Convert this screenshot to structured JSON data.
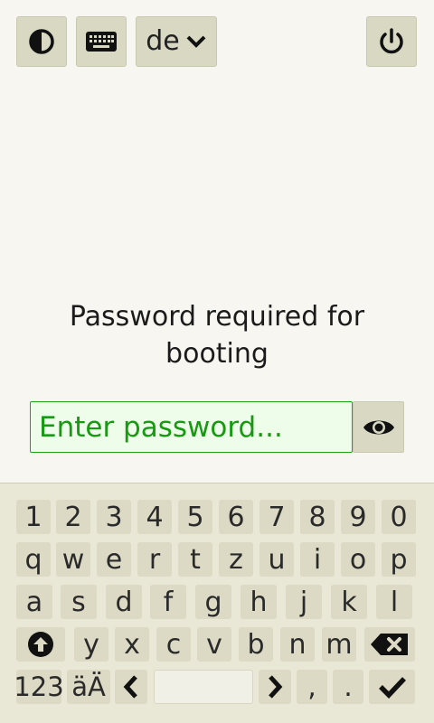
{
  "header": {
    "theme_icon": "half-circle-contrast-icon",
    "keyboard_icon": "keyboard-icon",
    "language": "de",
    "language_chevron_icon": "chevron-down-icon",
    "power_icon": "power-icon"
  },
  "prompt": {
    "title_line1": "Password required for",
    "title_line2": "booting"
  },
  "password": {
    "placeholder": "Enter password...",
    "value": "",
    "reveal_icon": "eye-icon"
  },
  "keyboard": {
    "row1": [
      "1",
      "2",
      "3",
      "4",
      "5",
      "6",
      "7",
      "8",
      "9",
      "0"
    ],
    "row2": [
      "q",
      "w",
      "e",
      "r",
      "t",
      "z",
      "u",
      "i",
      "o",
      "p"
    ],
    "row3": [
      "a",
      "s",
      "d",
      "f",
      "g",
      "h",
      "j",
      "k",
      "l"
    ],
    "row4": [
      "y",
      "x",
      "c",
      "v",
      "b",
      "n",
      "m"
    ],
    "shift_icon": "shift-arrow-up-icon",
    "backspace_icon": "backspace-icon",
    "mode_123": "123",
    "umlaut": "äÄ",
    "left_icon": "chevron-left-icon",
    "right_icon": "chevron-right-icon",
    "comma": ",",
    "period": ".",
    "enter_icon": "checkmark-icon"
  },
  "colors": {
    "background": "#f7f6f1",
    "button": "#d9d8c3",
    "key": "#dcdac4",
    "keyboard_bg": "#e9e7d6",
    "input_bg": "#eefcea",
    "input_accent": "#1ea51a"
  }
}
